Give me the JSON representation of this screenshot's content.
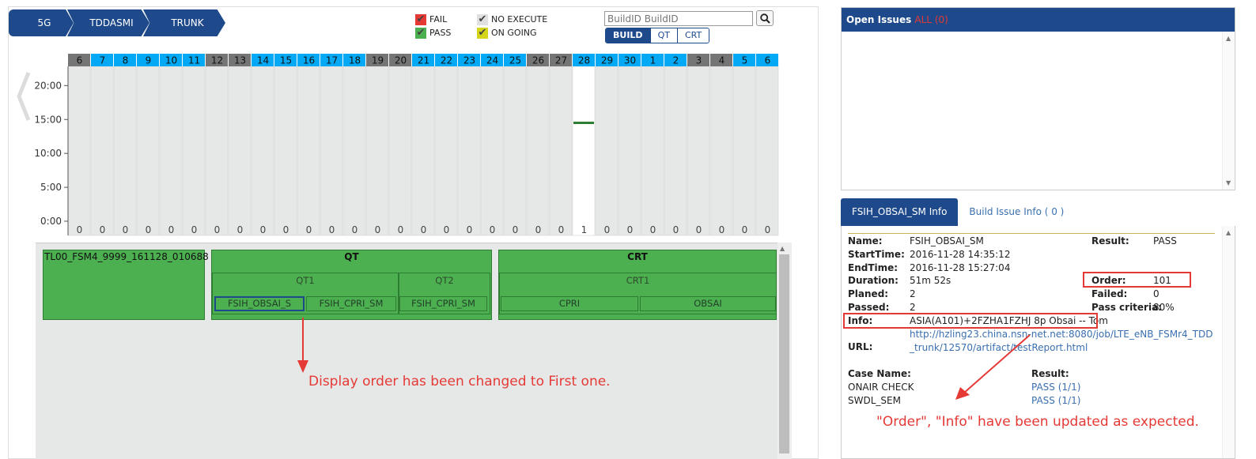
{
  "breadcrumb": [
    "5G",
    "TDDASMI",
    "TRUNK"
  ],
  "legend": {
    "fail": "FAIL",
    "pass": "PASS",
    "no_execute": "NO EXECUTE",
    "on_going": "ON GOING",
    "colors": {
      "fail": "#e53935",
      "pass": "#4caf50",
      "no_execute": "#dddddd",
      "on_going": "#d4d41a"
    }
  },
  "search": {
    "placeholder": "BuildID BuildID",
    "icon": "search-icon"
  },
  "view_buttons": {
    "build": "BUILD",
    "qt": "QT",
    "crt": "CRT",
    "active": "build"
  },
  "chart_data": {
    "type": "bar",
    "categories": [
      "6",
      "7",
      "8",
      "9",
      "10",
      "11",
      "12",
      "13",
      "14",
      "15",
      "16",
      "17",
      "18",
      "19",
      "20",
      "21",
      "22",
      "23",
      "24",
      "25",
      "26",
      "27",
      "28",
      "29",
      "30",
      "1",
      "2",
      "3",
      "4",
      "5",
      "6"
    ],
    "header_color": [
      "gray",
      "blue",
      "blue",
      "blue",
      "blue",
      "blue",
      "gray",
      "gray",
      "blue",
      "blue",
      "blue",
      "blue",
      "blue",
      "gray",
      "gray",
      "blue",
      "blue",
      "blue",
      "blue",
      "blue",
      "gray",
      "gray",
      "blue",
      "blue",
      "blue",
      "blue",
      "blue",
      "gray",
      "gray",
      "blue",
      "blue"
    ],
    "counts": [
      0,
      0,
      0,
      0,
      0,
      0,
      0,
      0,
      0,
      0,
      0,
      0,
      0,
      0,
      0,
      0,
      0,
      0,
      0,
      0,
      0,
      0,
      1,
      0,
      0,
      0,
      0,
      0,
      0,
      0,
      0
    ],
    "selected_index": 22,
    "yticks": [
      "0:00",
      "5:00",
      "10:00",
      "15:00",
      "20:00"
    ],
    "ylim": [
      0,
      24
    ],
    "marks": [
      {
        "index": 22,
        "y": 14.5,
        "color": "#2e7d32"
      }
    ],
    "colors": {
      "blue": "#03a9f4",
      "gray": "#757575",
      "bar_bg": "#e6e8e8",
      "selected_bg": "#ffffff"
    }
  },
  "build": {
    "name": "TL00_FSM4_9999_161128_010688",
    "qt": {
      "label": "QT",
      "groups": [
        {
          "label": "QT1",
          "items": [
            "FSIH_OBSAI_S",
            "FSIH_CPRI_SM"
          ]
        },
        {
          "label": "QT2",
          "items": [
            "FSIH_CPRI_SM"
          ]
        }
      ]
    },
    "crt": {
      "label": "CRT",
      "groups": [
        {
          "label": "CRT1",
          "items": [
            "CPRI",
            "OBSAI"
          ]
        }
      ]
    }
  },
  "annotations": {
    "left": "Display order has been changed to First one.",
    "right": "\"Order\", \"Info\" have been updated as expected."
  },
  "issues": {
    "title": "Open Issues",
    "filter": "ALL (0)"
  },
  "tabs": {
    "info": "FSIH_OBSAI_SM Info",
    "build_issue": "Build Issue Info ( 0 )"
  },
  "info": {
    "name_label": "Name:",
    "name": "FSIH_OBSAI_SM",
    "result_label": "Result:",
    "result": "PASS",
    "start_label": "StartTime:",
    "start": "2016-11-28 14:35:12",
    "end_label": "EndTime:",
    "end": "2016-11-28 15:27:04",
    "duration_label": "Duration:",
    "duration": "51m 52s",
    "order_label": "Order:",
    "order": "101",
    "planed_label": "Planed:",
    "planed": "2",
    "failed_label": "Failed:",
    "failed": "0",
    "passed_label": "Passed:",
    "passed": "2",
    "criteria_label": "Pass criteria:",
    "criteria": "80%",
    "info_label": "Info:",
    "info": "ASIA(A101)+2FZHA1FZHJ 8p Obsai -- Tom",
    "url_label": "URL:",
    "url": "http://hzling23.china.nsn-net.net:8080/job/LTE_eNB_FSMr4_TDD_trunk/12570/artifact/testReport.html",
    "case_name_label": "Case Name:",
    "case_result_label": "Result:",
    "cases": [
      {
        "name": "ONAIR CHECK",
        "result": "PASS (1/1)"
      },
      {
        "name": "SWDL_SEM",
        "result": "PASS (1/1)"
      }
    ]
  }
}
